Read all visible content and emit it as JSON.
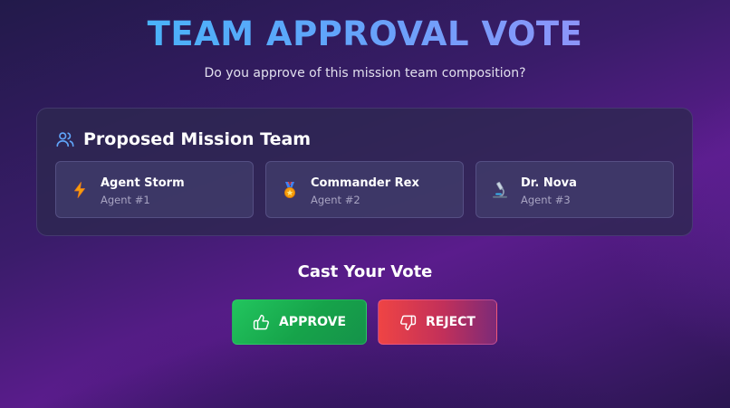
{
  "header": {
    "title": "TEAM APPROVAL VOTE",
    "subtitle": "Do you approve of this mission team composition?"
  },
  "team": {
    "icon": "users-icon",
    "title": "Proposed Mission Team",
    "agents": [
      {
        "name": "Agent Storm",
        "id": "Agent #1",
        "icon": "lightning-icon"
      },
      {
        "name": "Commander Rex",
        "id": "Agent #2",
        "icon": "medal-icon"
      },
      {
        "name": "Dr. Nova",
        "id": "Agent #3",
        "icon": "microscope-icon"
      }
    ]
  },
  "vote": {
    "title": "Cast Your Vote",
    "approve_label": "APPROVE",
    "approve_icon": "thumbs-up-icon",
    "reject_label": "REJECT",
    "reject_icon": "thumbs-down-icon"
  },
  "colors": {
    "title_gradient_start": "#38bdf8",
    "title_gradient_end": "#a78bfa",
    "approve": "#22c55e",
    "reject": "#ef4444",
    "accent_icon": "#60a5fa"
  }
}
